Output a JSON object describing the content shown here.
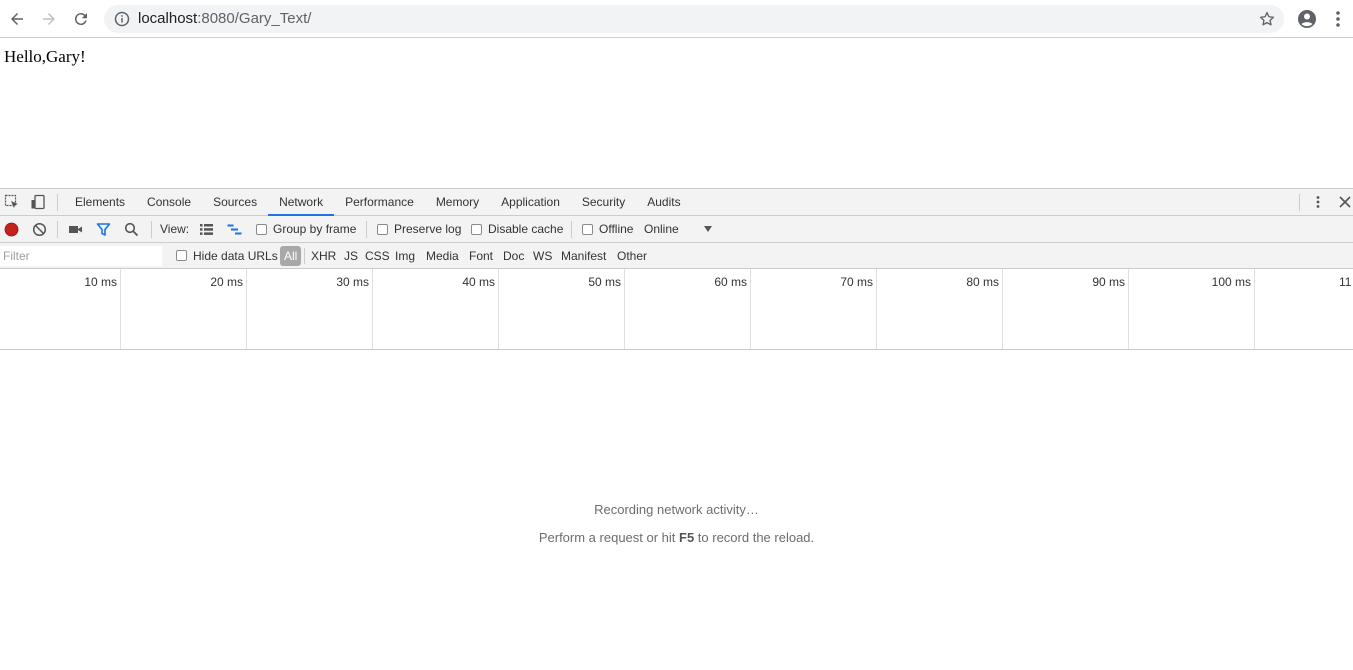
{
  "browser": {
    "url_host": "localhost",
    "url_rest": ":8080/Gary_Text/"
  },
  "page": {
    "greeting": "Hello,Gary!"
  },
  "devtools": {
    "tabs": [
      {
        "label": "Elements"
      },
      {
        "label": "Console"
      },
      {
        "label": "Sources"
      },
      {
        "label": "Network",
        "active": true
      },
      {
        "label": "Performance"
      },
      {
        "label": "Memory"
      },
      {
        "label": "Application"
      },
      {
        "label": "Security"
      },
      {
        "label": "Audits"
      }
    ],
    "toolbar": {
      "view_label": "View:",
      "group_by_frame": "Group by frame",
      "preserve_log": "Preserve log",
      "disable_cache": "Disable cache",
      "offline": "Offline",
      "throttling": "Online"
    },
    "filter": {
      "placeholder": "Filter",
      "hide_data_urls": "Hide data URLs",
      "types": [
        "All",
        "XHR",
        "JS",
        "CSS",
        "Img",
        "Media",
        "Font",
        "Doc",
        "WS",
        "Manifest",
        "Other"
      ]
    },
    "timeline_ticks": [
      "10 ms",
      "20 ms",
      "30 ms",
      "40 ms",
      "50 ms",
      "60 ms",
      "70 ms",
      "80 ms",
      "90 ms",
      "100 ms",
      "11"
    ],
    "empty": {
      "recording": "Recording network activity…",
      "hint_before": "Perform a request or hit ",
      "hint_key": "F5",
      "hint_after": " to record the reload."
    },
    "colors": {
      "record": "#c5221f",
      "filter_active": "#1a73e8",
      "tab_underline": "#1a73e8"
    }
  }
}
